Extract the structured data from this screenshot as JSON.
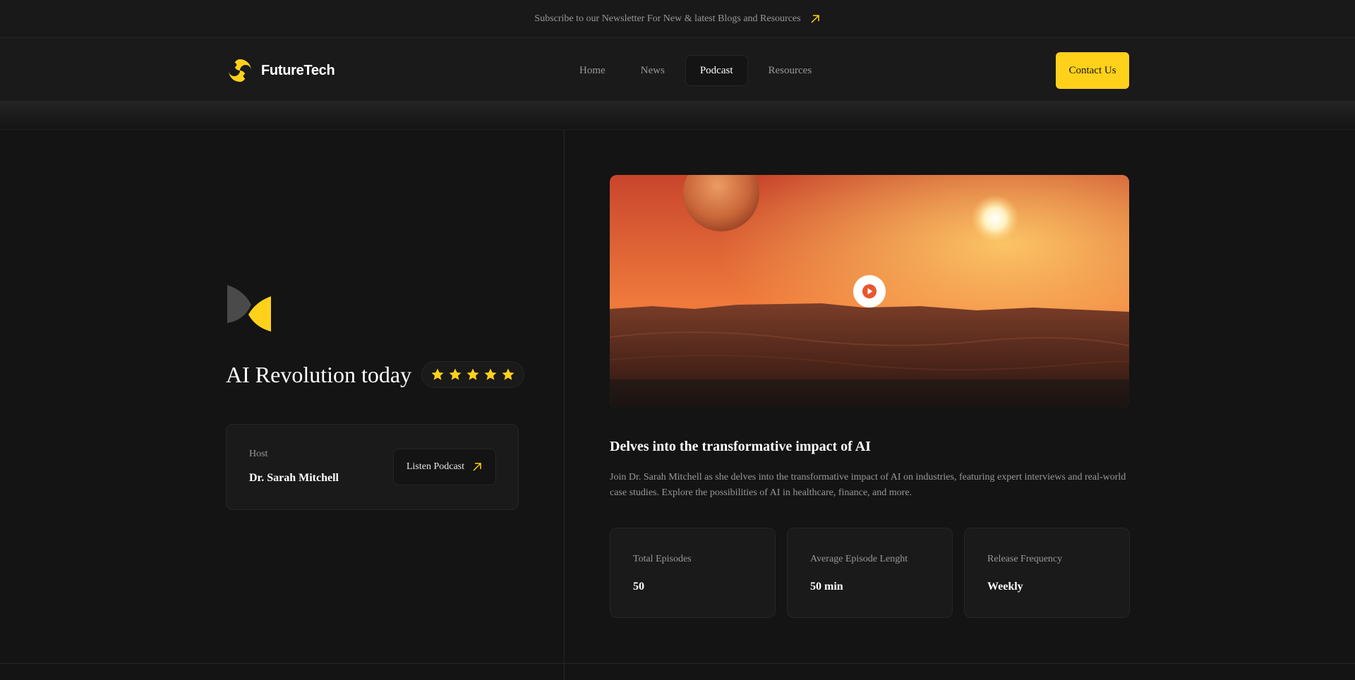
{
  "topbar": {
    "text": "Subscribe to our Newsletter For New & latest Blogs and Resources",
    "icon": "arrow-up-right-icon"
  },
  "brand": {
    "name": "FutureTech",
    "color": "#ffd11a"
  },
  "nav": {
    "items": [
      {
        "label": "Home",
        "active": false
      },
      {
        "label": "News",
        "active": false
      },
      {
        "label": "Podcast",
        "active": true
      },
      {
        "label": "Resources",
        "active": false
      }
    ],
    "cta": "Contact Us"
  },
  "podcast": {
    "title": "AI Revolution today",
    "rating": 5,
    "host_label": "Host",
    "host_name": "Dr. Sarah Mitchell",
    "listen_label": "Listen Podcast"
  },
  "episode": {
    "heading": "Delves into the transformative impact of AI",
    "description": "Join Dr. Sarah Mitchell as she delves into the transformative impact of AI on industries, featuring expert interviews and real-world case studies. Explore the possibilities of AI in healthcare, finance, and more.",
    "stats": [
      {
        "label": "Total Episodes",
        "value": "50"
      },
      {
        "label": "Average Episode Lenght",
        "value": "50 min"
      },
      {
        "label": "Release Frequency",
        "value": "Weekly"
      }
    ]
  },
  "colors": {
    "background": "#141414",
    "surface": "#1a1a1a",
    "border": "#262626",
    "muted_text": "#98989a",
    "accent": "#ffd11a"
  }
}
